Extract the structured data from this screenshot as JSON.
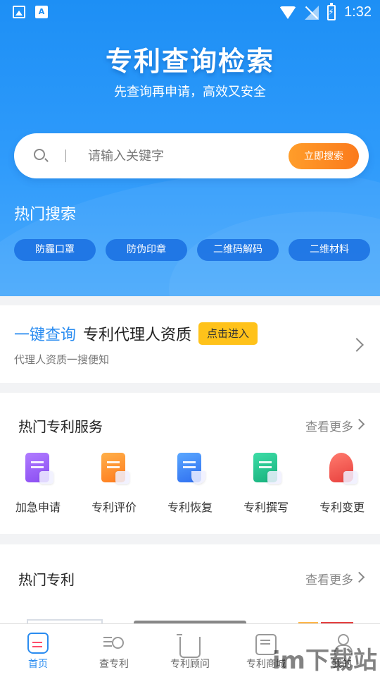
{
  "status_bar": {
    "time": "1:32"
  },
  "hero": {
    "title": "专利查询检索",
    "subtitle": "先查询再申请，高效又安全"
  },
  "search": {
    "placeholder": "请输入关键字",
    "button_label": "立即搜索"
  },
  "hot_search": {
    "title": "热门搜索",
    "tags": [
      "防霾口罩",
      "防伪印章",
      "二维码解码",
      "二维材料"
    ]
  },
  "agent_card": {
    "highlight": "一键查询",
    "title": "专利代理人资质",
    "badge": "点击进入",
    "subtitle": "代理人资质一搜便知"
  },
  "hot_services": {
    "title": "热门专利服务",
    "more": "查看更多",
    "items": [
      {
        "label": "加急申请",
        "icon": "expedite-apply-icon",
        "color": "#9b5cf6"
      },
      {
        "label": "专利评价",
        "icon": "patent-evaluation-icon",
        "color": "#ff8a2a"
      },
      {
        "label": "专利恢复",
        "icon": "patent-restore-icon",
        "color": "#2f7ff2"
      },
      {
        "label": "专利撰写",
        "icon": "patent-writing-icon",
        "color": "#1fbf8a"
      },
      {
        "label": "专利变更",
        "icon": "patent-change-icon",
        "color": "#f0524f"
      }
    ]
  },
  "hot_patents": {
    "title": "热门专利",
    "more": "查看更多"
  },
  "tabbar": {
    "items": [
      {
        "label": "首页",
        "icon": "home-icon",
        "active": true
      },
      {
        "label": "查专利",
        "icon": "search-patent-icon",
        "active": false
      },
      {
        "label": "专利顾问",
        "icon": "cart-icon",
        "active": false
      },
      {
        "label": "专利商城",
        "icon": "chat-icon",
        "active": false
      },
      {
        "label": "我的",
        "icon": "user-icon",
        "active": false
      }
    ]
  },
  "watermark": "im下载站",
  "colors": {
    "primary": "#2a8cf0",
    "accent_orange": "#fb7a1c",
    "badge_yellow": "#ffc21a"
  }
}
